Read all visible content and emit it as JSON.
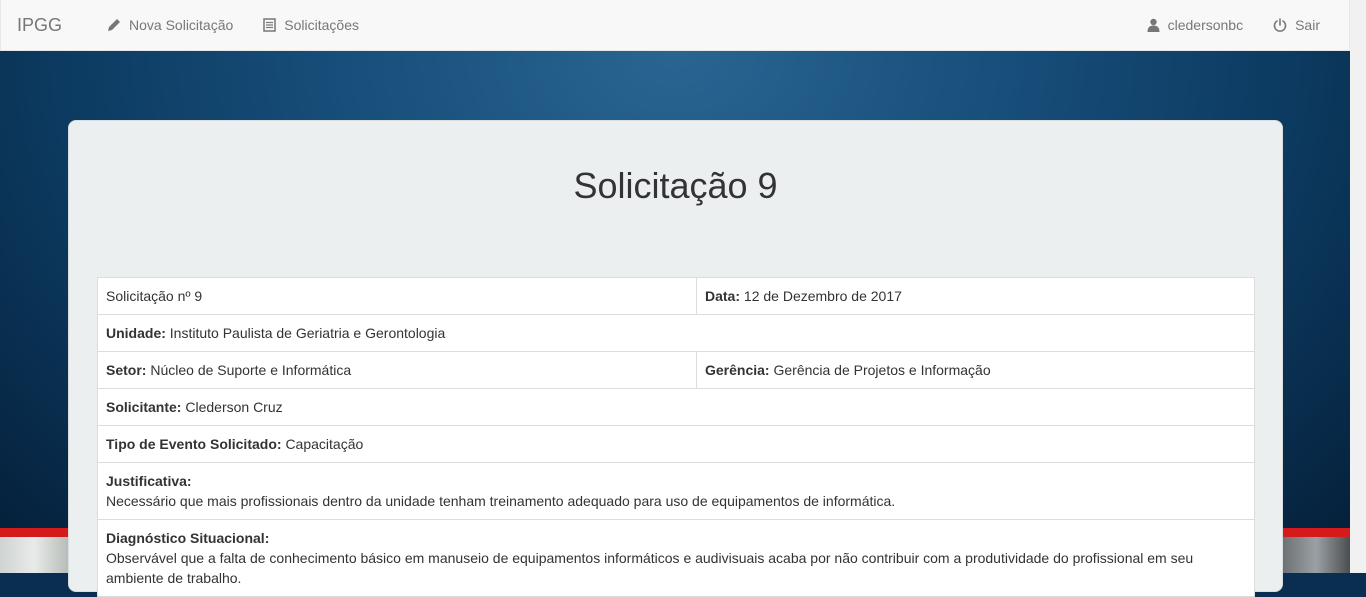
{
  "navbar": {
    "brand": "IPGG",
    "new_request": "Nova Solicitação",
    "requests": "Solicitações",
    "user": "cledersonbc",
    "logout": "Sair"
  },
  "page": {
    "title": "Solicitação 9"
  },
  "details": {
    "number_text": "Solicitação nº 9",
    "date_label": "Data:",
    "date_value": "12 de Dezembro de 2017",
    "unit_label": "Unidade:",
    "unit_value": "Instituto Paulista de Geriatria e Gerontologia",
    "sector_label": "Setor:",
    "sector_value": "Núcleo de Suporte e Informática",
    "management_label": "Gerência:",
    "management_value": "Gerência de Projetos e Informação",
    "requester_label": "Solicitante:",
    "requester_value": "Clederson Cruz",
    "event_type_label": "Tipo de Evento Solicitado:",
    "event_type_value": "Capacitação",
    "justification_label": "Justificativa:",
    "justification_value": "Necessário que mais profissionais dentro da unidade tenham treinamento adequado para uso de equipamentos de informática.",
    "diagnosis_label": "Diagnóstico Situacional:",
    "diagnosis_value": "Observável que a falta de conhecimento básico em manuseio de equipamentos informáticos e audivisuais acaba por não contribuir com a produtividade do profissional em seu ambiente de trabalho."
  },
  "colors": {
    "navbar_bg": "#f8f8f8",
    "background_blue": "#174e7a",
    "card_bg": "#eceff0",
    "stripe_red": "#d41a1a"
  },
  "icons": {
    "new_request": "pencil-icon",
    "requests": "list-icon",
    "user": "user-icon",
    "logout": "power-icon"
  }
}
